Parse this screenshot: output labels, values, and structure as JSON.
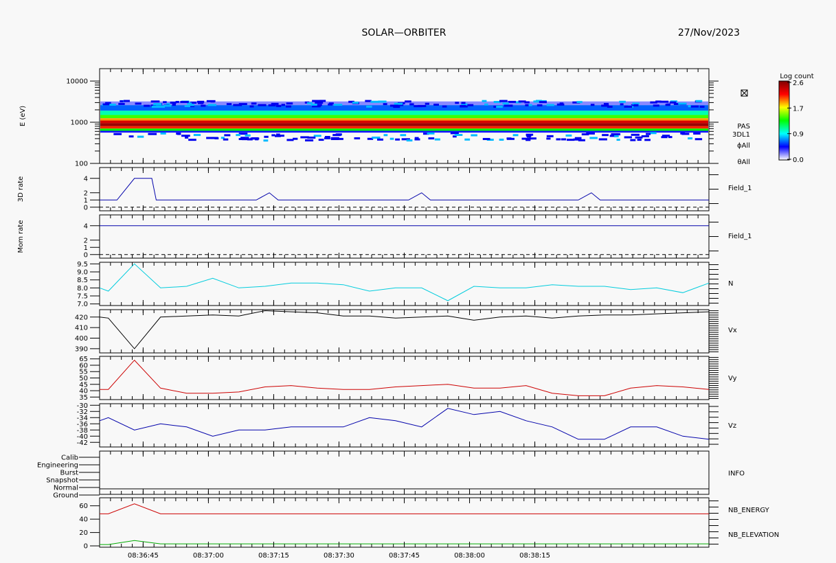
{
  "header": {
    "title": "SOLAR—ORBITER",
    "date": "27/Nov/2023"
  },
  "colorbar": {
    "title": "Log count",
    "ticks": [
      "2.6",
      "1.7",
      "0.9",
      "0.0"
    ],
    "colors": [
      "#ffffff",
      "#0000ff",
      "#00ffff",
      "#00ff00",
      "#ffff00",
      "#ff0000",
      "#800000"
    ]
  },
  "x_axis": {
    "ticks": [
      "08:36:45",
      "08:37:00",
      "08:37:15",
      "08:37:30",
      "08:37:45",
      "08:38:00",
      "08:38:15"
    ]
  },
  "chart_data": [
    {
      "type": "heatmap",
      "name": "spectrogram",
      "ylabel": "E (eV)",
      "yscale": "log",
      "ylim": [
        100,
        20000
      ],
      "yticks": [
        "10000",
        "1000",
        "100"
      ],
      "right_labels": [
        "PAS",
        "3DL1",
        "ϕAll",
        "θAll"
      ],
      "z_range": [
        0.0,
        2.6
      ],
      "bands": [
        {
          "e_low": 2600,
          "e_high": 3200,
          "log_count": 0.2
        },
        {
          "e_low": 1900,
          "e_high": 2600,
          "log_count": 0.6
        },
        {
          "e_low": 1500,
          "e_high": 1900,
          "log_count": 1.0
        },
        {
          "e_low": 1250,
          "e_high": 1500,
          "log_count": 1.4
        },
        {
          "e_low": 1100,
          "e_high": 1250,
          "log_count": 1.9
        },
        {
          "e_low": 950,
          "e_high": 1100,
          "log_count": 2.3
        },
        {
          "e_low": 800,
          "e_high": 950,
          "log_count": 2.5
        },
        {
          "e_low": 700,
          "e_high": 800,
          "log_count": 2.1
        },
        {
          "e_low": 620,
          "e_high": 700,
          "log_count": 1.3
        },
        {
          "e_low": 560,
          "e_high": 620,
          "log_count": 0.4
        }
      ]
    },
    {
      "type": "line",
      "name": "3d-rate",
      "ylabel": "3D rate",
      "ylim": [
        -0.5,
        5.5
      ],
      "yticks": [
        0,
        1,
        2,
        4
      ],
      "series": [
        {
          "name": "Field_1",
          "color": "#0000aa",
          "t": [
            0,
            4,
            8,
            12,
            13,
            36,
            39,
            41,
            71,
            74,
            76,
            110,
            113,
            115,
            140
          ],
          "values": [
            1,
            1,
            4,
            4,
            1,
            1,
            2,
            1,
            1,
            2,
            1,
            1,
            2,
            1,
            1
          ]
        }
      ],
      "dashed_zero": true
    },
    {
      "type": "line",
      "name": "mom-rate",
      "ylabel": "Mom rate",
      "ylim": [
        -0.5,
        5.5
      ],
      "yticks": [
        0,
        1,
        2,
        4
      ],
      "series": [
        {
          "name": "Field_1",
          "color": "#0000aa",
          "t": [
            0,
            140
          ],
          "values": [
            4,
            4
          ]
        }
      ],
      "dashed_zero": true
    },
    {
      "type": "line",
      "name": "density",
      "ylim": [
        6.9,
        9.6
      ],
      "yticks": [
        7.0,
        7.5,
        8.0,
        8.5,
        9.0,
        9.5
      ],
      "series": [
        {
          "name": "N",
          "color": "#00ccdd",
          "t": [
            0,
            2,
            8,
            14,
            20,
            26,
            32,
            38,
            44,
            50,
            56,
            62,
            68,
            74,
            80,
            86,
            92,
            98,
            104,
            110,
            116,
            122,
            128,
            134,
            140
          ],
          "values": [
            8.0,
            7.8,
            9.5,
            8.0,
            8.1,
            8.6,
            8.0,
            8.1,
            8.3,
            8.3,
            8.2,
            7.8,
            8.0,
            8.0,
            7.2,
            8.1,
            8.0,
            8.0,
            8.2,
            8.1,
            8.1,
            7.9,
            8.0,
            7.7,
            8.3
          ]
        }
      ]
    },
    {
      "type": "line",
      "name": "vx",
      "ylim": [
        386,
        427
      ],
      "yticks": [
        390,
        400,
        410,
        420
      ],
      "series": [
        {
          "name": "Vx",
          "color": "#000000",
          "t": [
            0,
            2,
            8,
            14,
            20,
            26,
            32,
            38,
            44,
            50,
            56,
            62,
            68,
            74,
            80,
            86,
            92,
            98,
            104,
            110,
            116,
            122,
            128,
            134,
            140
          ],
          "values": [
            420,
            419,
            390,
            420,
            421,
            422,
            421,
            426,
            425,
            424,
            421,
            421,
            419,
            420,
            421,
            417,
            420,
            421,
            419,
            421,
            422,
            422,
            423,
            424,
            425
          ]
        }
      ]
    },
    {
      "type": "line",
      "name": "vy",
      "ylim": [
        33,
        67
      ],
      "yticks": [
        35,
        40,
        45,
        50,
        55,
        60,
        65
      ],
      "series": [
        {
          "name": "Vy",
          "color": "#cc0000",
          "t": [
            0,
            2,
            8,
            14,
            20,
            26,
            32,
            38,
            44,
            50,
            56,
            62,
            68,
            74,
            80,
            86,
            92,
            98,
            104,
            110,
            116,
            122,
            128,
            134,
            140
          ],
          "values": [
            41,
            41,
            64,
            42,
            38,
            38,
            39,
            43,
            44,
            42,
            41,
            41,
            43,
            44,
            45,
            42,
            42,
            44,
            38,
            36,
            36,
            42,
            44,
            43,
            41
          ]
        }
      ]
    },
    {
      "type": "line",
      "name": "vz",
      "ylim": [
        -43.5,
        -29.5
      ],
      "yticks": [
        -42,
        -40,
        -38,
        -36,
        -34,
        -32,
        -30
      ],
      "series": [
        {
          "name": "Vz",
          "color": "#0000aa",
          "t": [
            0,
            2,
            8,
            14,
            20,
            26,
            32,
            38,
            44,
            50,
            56,
            62,
            68,
            74,
            80,
            86,
            92,
            98,
            104,
            110,
            116,
            122,
            128,
            134,
            140
          ],
          "values": [
            -35,
            -34,
            -38,
            -36,
            -37,
            -40,
            -38,
            -38,
            -37,
            -37,
            -37,
            -34,
            -35,
            -37,
            -31,
            -33,
            -32,
            -35,
            -37,
            -41,
            -41,
            -37,
            -37,
            -40,
            -41
          ]
        }
      ]
    },
    {
      "type": "table",
      "name": "info",
      "categories": [
        "Calib",
        "Engineering",
        "Burst",
        "Snapshot",
        "Normal",
        "Ground"
      ],
      "right_label": "INFO",
      "active": "Normal"
    },
    {
      "type": "line",
      "name": "nb",
      "ylim": [
        -2,
        72
      ],
      "yticks": [
        0,
        20,
        40,
        60
      ],
      "series": [
        {
          "name": "NB_ENERGY",
          "color": "#cc0000",
          "t": [
            0,
            2,
            8,
            14,
            140
          ],
          "values": [
            48,
            48,
            63,
            48,
            48
          ]
        },
        {
          "name": "NB_ELEVATION",
          "color": "#00aa00",
          "t": [
            0,
            2,
            8,
            14,
            140
          ],
          "values": [
            2,
            2,
            8,
            3,
            3
          ]
        }
      ]
    }
  ]
}
